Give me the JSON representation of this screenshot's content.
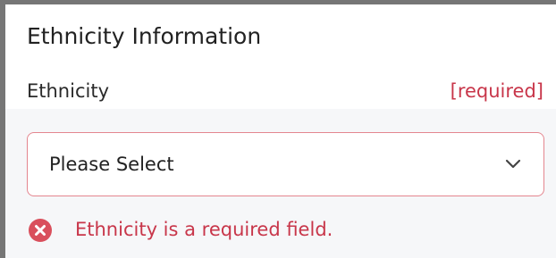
{
  "section": {
    "title": "Ethnicity Information"
  },
  "field": {
    "label": "Ethnicity",
    "required_tag": "[required]",
    "selected_value": "Please Select",
    "error_message": "Ethnicity is a required field."
  },
  "colors": {
    "error": "#c8364a",
    "invalid_border": "#e4868f",
    "error_icon_bg": "#d94f5c"
  },
  "icons": {
    "dropdown": "chevron-down-icon",
    "error": "error-x-circle-icon"
  }
}
